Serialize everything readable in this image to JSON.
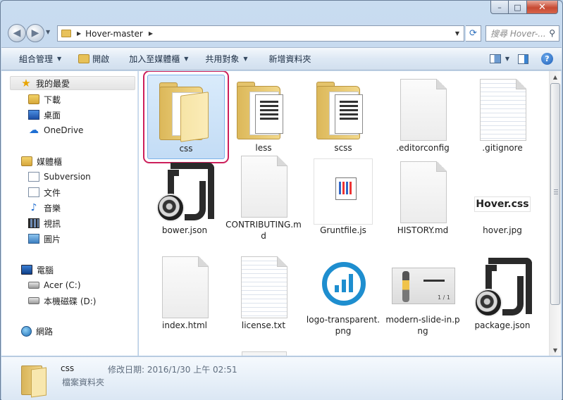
{
  "window": {
    "caption": {
      "minimize": "–",
      "maximize": "□",
      "close": "✕"
    }
  },
  "address": {
    "path": "Hover-master",
    "search_placeholder": "搜尋 Hover-..."
  },
  "toolbar": {
    "organize": "組合管理",
    "open": "開啟",
    "add_library": "加入至媒體櫃",
    "share": "共用對象",
    "new_folder": "新增資料夾"
  },
  "sidebar": {
    "favorites": "我的最愛",
    "downloads": "下載",
    "desktop": "桌面",
    "onedrive": "OneDrive",
    "libraries": "媒體櫃",
    "subversion": "Subversion",
    "documents": "文件",
    "music": "音樂",
    "videos": "視訊",
    "pictures": "圖片",
    "computer": "電腦",
    "acer": "Acer (C:)",
    "local_disk": "本機磁碟 (D:)",
    "network": "網路"
  },
  "files": [
    {
      "name": "css",
      "kind": "folder"
    },
    {
      "name": "less",
      "kind": "folder-doc"
    },
    {
      "name": "scss",
      "kind": "folder-doc"
    },
    {
      "name": ".editorconfig",
      "kind": "file"
    },
    {
      "name": ".gitignore",
      "kind": "file-lined"
    },
    {
      "name": "bower.json",
      "kind": "json"
    },
    {
      "name": "CONTRIBUTING.md",
      "kind": "file"
    },
    {
      "name": "Gruntfile.js",
      "kind": "grunt"
    },
    {
      "name": "HISTORY.md",
      "kind": "file"
    },
    {
      "name": "hover.jpg",
      "kind": "hover",
      "thumb_text": "Hover.css"
    },
    {
      "name": "index.html",
      "kind": "file"
    },
    {
      "name": "license.txt",
      "kind": "file-lined"
    },
    {
      "name": "logo-transparent.png",
      "kind": "logo"
    },
    {
      "name": "modern-slide-in.png",
      "kind": "slide",
      "thumb_text": "1 / 1"
    },
    {
      "name": "package.json",
      "kind": "json"
    }
  ],
  "details": {
    "name": "css",
    "modified": "修改日期: 2016/1/30 上午 02:51",
    "type": "檔案資料夾"
  }
}
